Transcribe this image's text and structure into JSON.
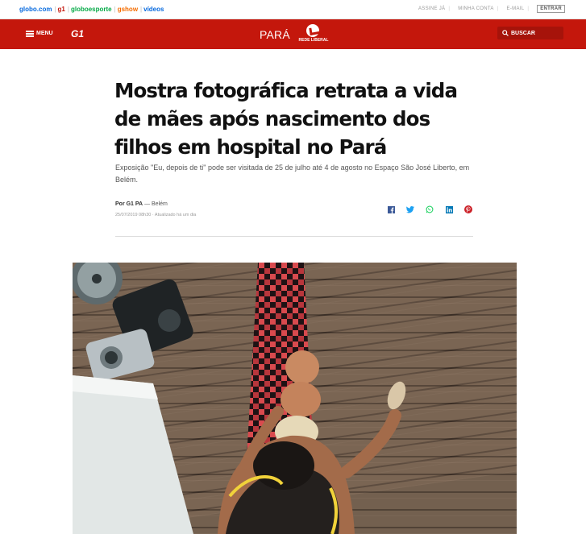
{
  "portals": {
    "globo": "globo.com",
    "g1": "g1",
    "globoesporte": "globoesporte",
    "gshow": "gshow",
    "videos": "vídeos"
  },
  "toplinks": {
    "assine": "ASSINE JÁ",
    "minha_conta": "MINHA CONTA",
    "email": "E-MAIL",
    "entrar": "ENTRAR"
  },
  "header": {
    "menu_label": "MENU",
    "logo": "G1",
    "state": "PARÁ",
    "affiliate": "REDE LIBERAL",
    "search_label": "BUSCAR"
  },
  "article": {
    "title": "Mostra fotográfica retrata a vida de mães após nascimento dos filhos em hospital no Pará",
    "subtitle": "Exposição \"Eu, depois de ti\" pode ser visitada de 25 de julho até 4 de agosto no Espaço São José Liberto, em Belém.",
    "byline_author": "Por G1 PA",
    "byline_place": "— Belém",
    "date": "25/07/2019 08h30 · Atualizado há um dia"
  },
  "share": [
    "facebook-icon",
    "twitter-icon",
    "whatsapp-icon",
    "linkedin-icon",
    "pinterest-icon"
  ],
  "colors": {
    "brand_red": "#c4170c",
    "facebook": "#3b5998",
    "twitter": "#1da1f2",
    "whatsapp": "#25d366",
    "linkedin": "#0077b5",
    "pinterest": "#cb2027"
  }
}
